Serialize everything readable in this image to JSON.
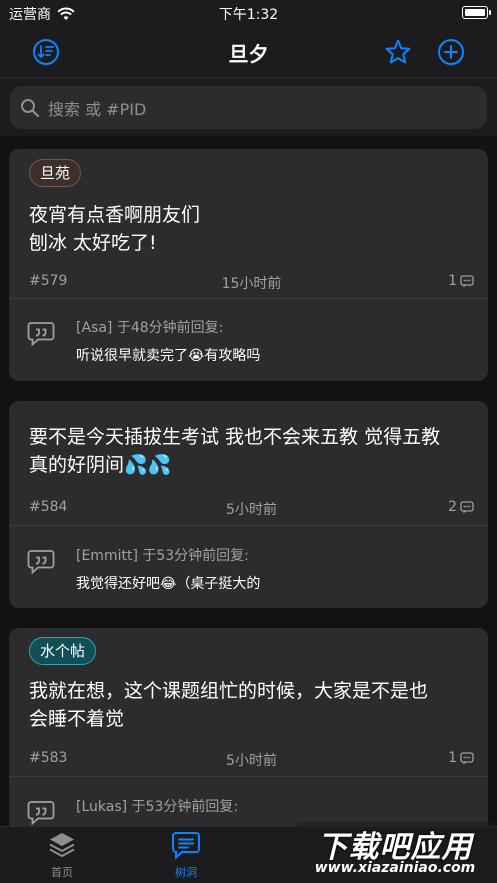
{
  "status_bar": {
    "carrier": "运营商",
    "time": "下午1:32"
  },
  "nav": {
    "title": "旦夕"
  },
  "search": {
    "placeholder": "搜索 或 #PID"
  },
  "posts": [
    {
      "tag": "旦苑",
      "text": [
        "夜宵有点香啊朋友们",
        "刨冰 太好吃了!"
      ],
      "pid": "#579",
      "time": "15小时前",
      "count": "1",
      "reply_head": "[Asa] 于48分钟前回复:",
      "reply_body": "听说很早就卖完了😭有攻略吗"
    },
    {
      "tag": "",
      "text": [
        "要不是今天插拔生考试 我也不会来五教 觉得五教",
        "真的好阴间💦💦"
      ],
      "pid": "#584",
      "time": "5小时前",
      "count": "2",
      "reply_head": "[Emmitt] 于53分钟前回复:",
      "reply_body": "我觉得还好吧😂（桌子挺大的"
    },
    {
      "tag": "水个帖",
      "text": [
        "我就在想，这个课题组忙的时候，大家是不是也",
        "会睡不着觉"
      ],
      "pid": "#583",
      "time": "5小时前",
      "count": "1",
      "reply_head": "[Lukas] 于53分钟前回复:",
      "reply_body": ""
    }
  ],
  "tabs": [
    {
      "label": "首页"
    },
    {
      "label": "树洞"
    }
  ],
  "watermark": {
    "main": "下载吧应用",
    "sub": "www.xiazainiao.com"
  },
  "colors": {
    "accent": "#0a84ff",
    "card": "#2c2c2e",
    "bar": "#1c1c1e"
  }
}
